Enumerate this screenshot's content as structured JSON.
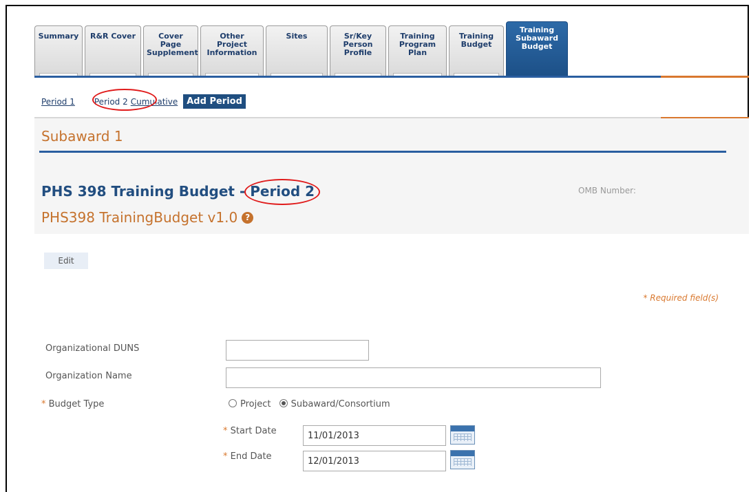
{
  "tabs": [
    {
      "label": "Summary"
    },
    {
      "label": "R&R Cover"
    },
    {
      "label": "Cover Page Supplement"
    },
    {
      "label": "Other Project Information"
    },
    {
      "label": "Sites"
    },
    {
      "label": "Sr/Key Person Profile"
    },
    {
      "label": "Training Program Plan"
    },
    {
      "label": "Training Budget"
    },
    {
      "label": "Training Subaward Budget"
    }
  ],
  "periods": {
    "items": [
      "Period 1",
      "Period 2",
      "Cumulative"
    ],
    "add_label": "Add Period"
  },
  "subaward_title": "Subaward 1",
  "form": {
    "heading_prefix": "PHS 398 Training Budget - ",
    "heading_period": "Period 2",
    "omb_label": "OMB Number:",
    "version": "PHS398 TrainingBudget v1.0",
    "help_glyph": "?",
    "edit_label": "Edit",
    "required_note": "* Required field(s)",
    "fields": {
      "duns_label": "Organizational DUNS",
      "duns_value": "",
      "org_name_label": "Organization Name",
      "org_name_value": "",
      "budget_type_label": "Budget Type",
      "budget_type_options": [
        "Project",
        "Subaward/Consortium"
      ],
      "budget_type_selected": "Subaward/Consortium",
      "start_date_label": "Start Date",
      "start_date_value": "11/01/2013",
      "end_date_label": "End Date",
      "end_date_value": "12/01/2013"
    }
  },
  "colors": {
    "tab_active": "#1c4f86",
    "accent_blue": "#2a5ea0",
    "accent_orange": "#d9782e",
    "highlight_circle": "#e01b1b"
  }
}
